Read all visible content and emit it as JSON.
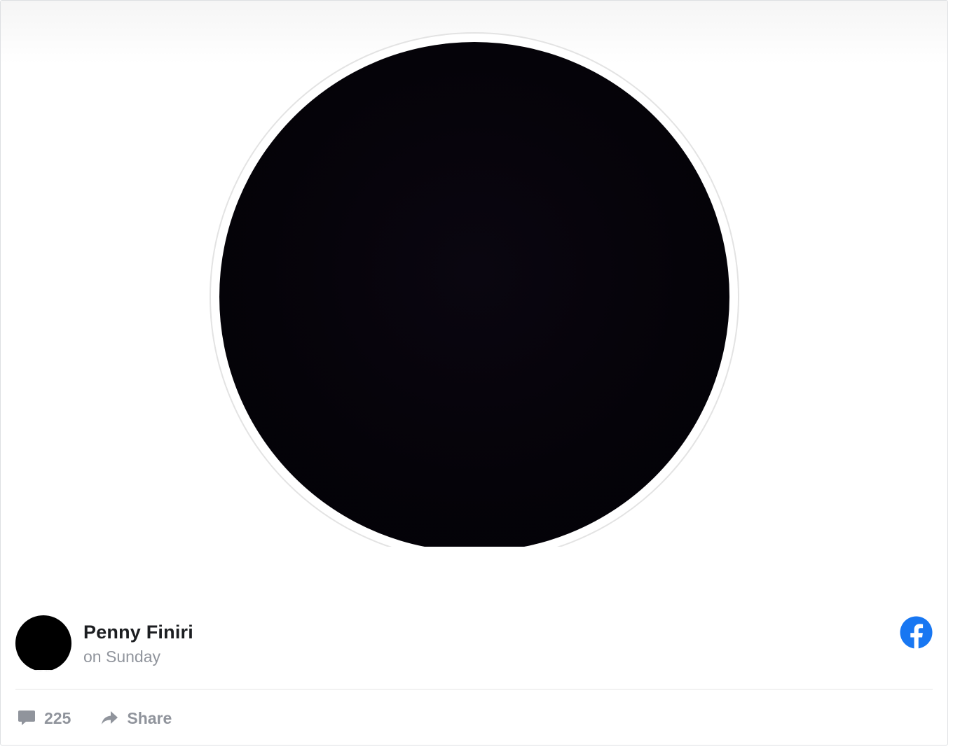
{
  "post": {
    "author_name": "Penny Finiri",
    "timestamp": "on Sunday"
  },
  "actions": {
    "comment_count": "225",
    "share_label": "Share"
  },
  "icons": {
    "brand": "facebook-logo-icon",
    "comment": "comment-bubble-icon",
    "share": "share-arrow-icon"
  },
  "colors": {
    "facebook_blue": "#1877f2",
    "muted_text": "#90949c",
    "author_text": "#1c1e21",
    "photo_fill": "#050309"
  }
}
